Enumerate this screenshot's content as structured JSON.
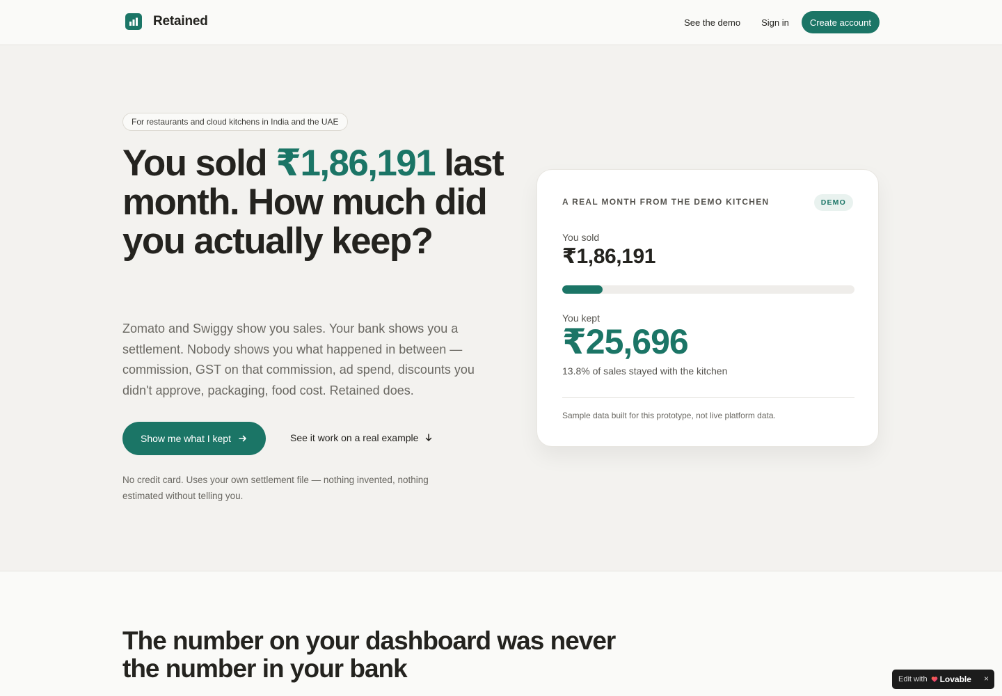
{
  "header": {
    "brand": "Retained",
    "nav": {
      "demo": "See the demo",
      "signin": "Sign in",
      "create": "Create account"
    }
  },
  "hero": {
    "eyebrow": "For restaurants and cloud kitchens in India and the UAE",
    "headline_pre": "You sold ",
    "headline_amount": "₹1,86,191",
    "headline_post": " last month. How much did you actually keep?",
    "subtext": "Zomato and Swiggy show you sales. Your bank shows you a settlement. Nobody shows you what happened in between — commission, GST on that commission, ad spend, discounts you didn't approve, packaging, food cost. Retained does.",
    "primary_cta": "Show me what I kept",
    "secondary_cta": "See it work on a real example",
    "fine_print": "No credit card. Uses your own settlement file — nothing invented, nothing estimated without telling you."
  },
  "card": {
    "eyebrow": "A REAL MONTH FROM THE DEMO KITCHEN",
    "badge": "DEMO",
    "sold_label": "You sold",
    "sold_value": "₹1,86,191",
    "kept_fraction": 0.138,
    "kept_label": "You kept",
    "kept_value": "₹25,696",
    "kept_note": "13.8% of sales stayed with the kitchen",
    "footnote": "Sample data built for this prototype, not live platform data."
  },
  "section2": {
    "title": "The number on your dashboard was never the number in your bank"
  },
  "badge": {
    "edit_with": "Edit with",
    "brand": "Lovable",
    "close": "×"
  },
  "colors": {
    "accent": "#1b7566",
    "page_bg": "#f3f2ef",
    "text": "#24231f",
    "muted": "#6a6862"
  }
}
